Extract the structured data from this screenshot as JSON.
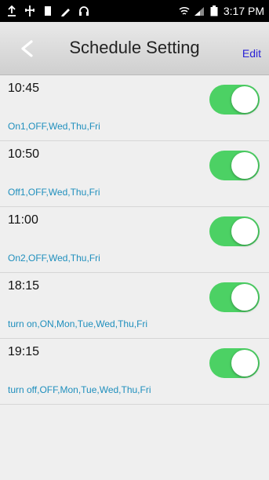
{
  "status_bar": {
    "time": "3:17 PM",
    "left_icons": [
      "upload-icon",
      "usb-icon",
      "sim-icon",
      "pen-icon",
      "headset-icon"
    ],
    "right_icons": [
      "wifi-icon",
      "signal-icon",
      "battery-icon"
    ]
  },
  "header": {
    "back_glyph": "<",
    "title": "Schedule Setting",
    "edit_label": "Edit"
  },
  "colors": {
    "toggle_on": "#4cd164",
    "description_text": "#1f8fbd",
    "edit_link": "#2a22d6"
  },
  "schedules": [
    {
      "time": "10:45",
      "description": "On1,OFF,Wed,Thu,Fri",
      "enabled": true
    },
    {
      "time": "10:50",
      "description": "Off1,OFF,Wed,Thu,Fri",
      "enabled": true
    },
    {
      "time": "11:00",
      "description": "On2,OFF,Wed,Thu,Fri",
      "enabled": true
    },
    {
      "time": "18:15",
      "description": "turn on,ON,Mon,Tue,Wed,Thu,Fri",
      "enabled": true
    },
    {
      "time": "19:15",
      "description": "turn off,OFF,Mon,Tue,Wed,Thu,Fri",
      "enabled": true
    }
  ]
}
